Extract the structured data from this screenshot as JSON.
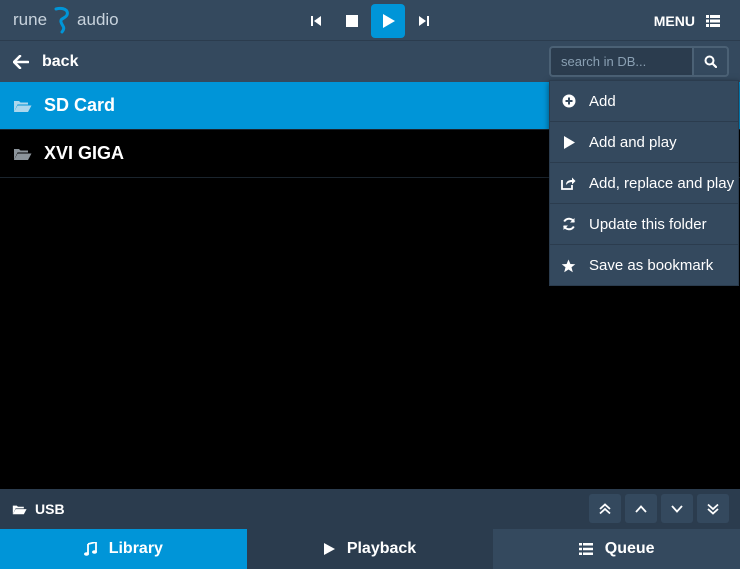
{
  "header": {
    "logo_left": "rune",
    "logo_right": "audio",
    "menu_label": "MENU",
    "accent_color": "#0095d8",
    "transport": [
      "previous-icon",
      "stop-icon",
      "play-icon",
      "next-icon"
    ]
  },
  "nav": {
    "back_label": "back",
    "search_placeholder": "search in DB..."
  },
  "list": {
    "items": [
      {
        "label": "SD Card",
        "icon": "folder-open-icon",
        "selected": true
      },
      {
        "label": "XVI GIGA",
        "icon": "folder-open-icon",
        "selected": false
      }
    ]
  },
  "context_menu": {
    "items": [
      {
        "label": "Add",
        "icon": "plus-circle-icon"
      },
      {
        "label": "Add and play",
        "icon": "play-icon"
      },
      {
        "label": "Add, replace and play",
        "icon": "share-icon"
      },
      {
        "label": "Update this folder",
        "icon": "refresh-icon"
      },
      {
        "label": "Save as bookmark",
        "icon": "star-icon"
      }
    ]
  },
  "footer": {
    "path_label": "USB",
    "scroll_buttons": [
      "double-up-icon",
      "up-icon",
      "down-icon",
      "double-down-icon"
    ]
  },
  "tabs": [
    {
      "label": "Library",
      "icon": "music-note-icon"
    },
    {
      "label": "Playback",
      "icon": "play-icon"
    },
    {
      "label": "Queue",
      "icon": "list-icon"
    }
  ]
}
